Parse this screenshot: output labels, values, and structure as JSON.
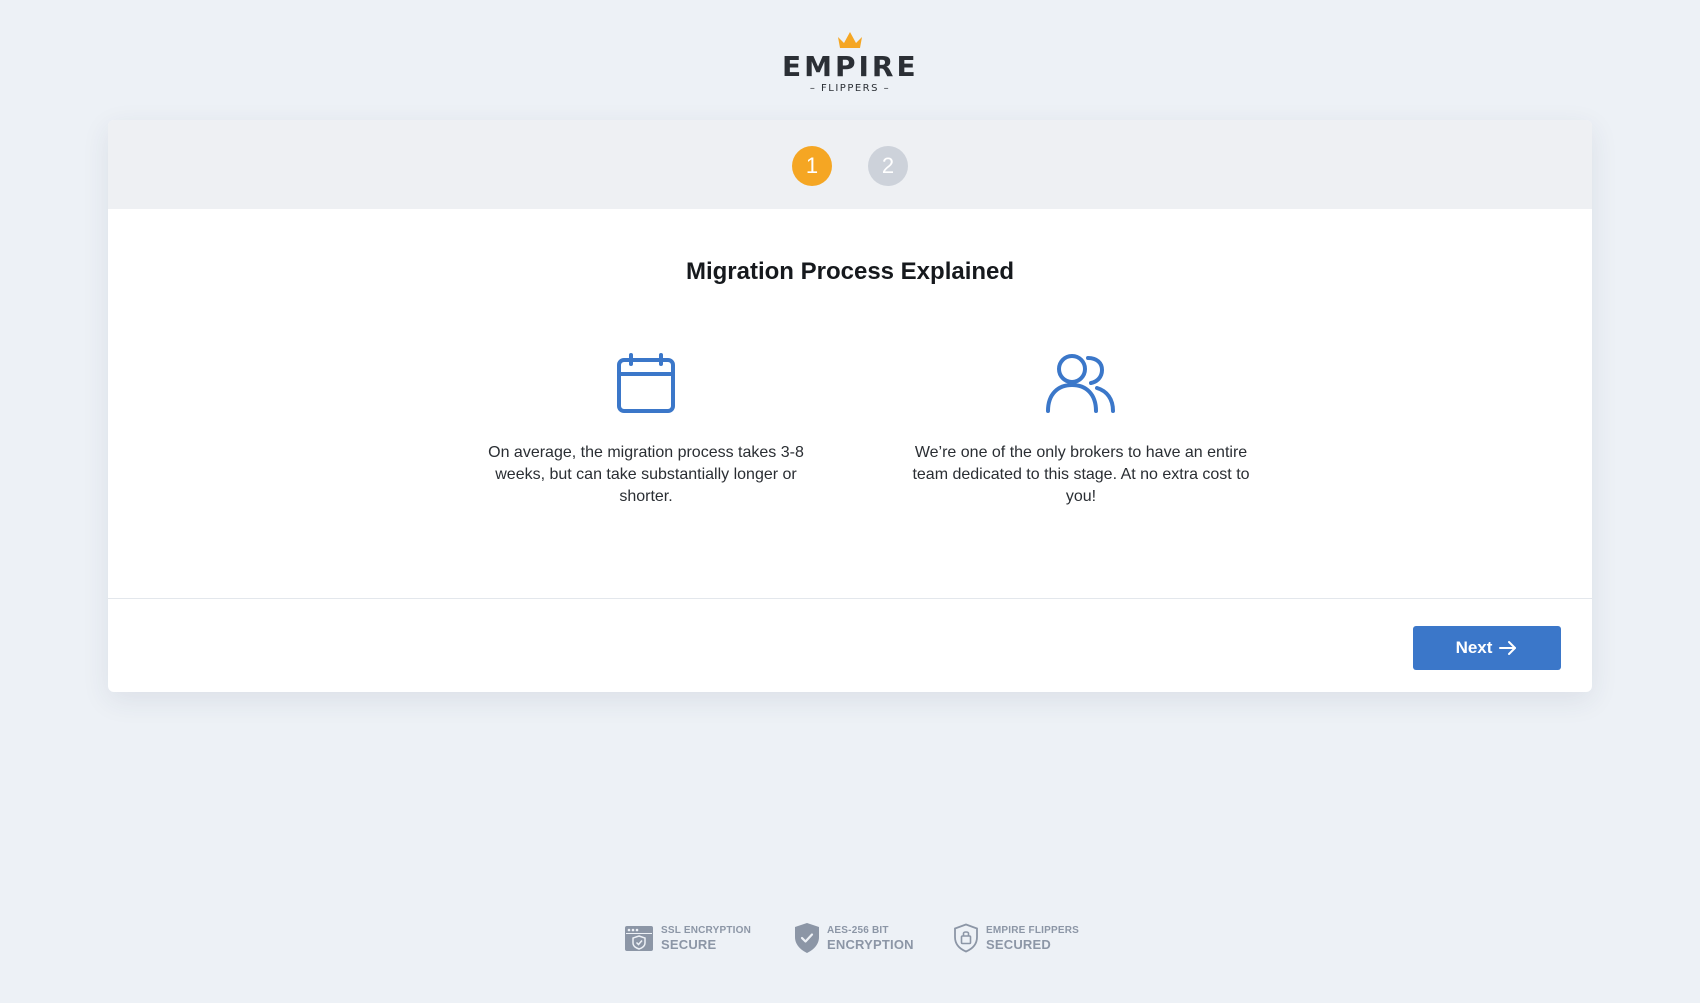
{
  "brand": {
    "name": "EMPIRE",
    "sub": "– FLIPPERS –",
    "crown_color": "#f5a623"
  },
  "stepper": {
    "steps": [
      {
        "label": "1",
        "state": "active"
      },
      {
        "label": "2",
        "state": "inactive"
      }
    ],
    "active_color": "#f5a623",
    "inactive_color": "#cdd2da"
  },
  "main": {
    "title": "Migration Process Explained",
    "features": [
      {
        "icon": "calendar-icon",
        "text": "On average, the migration process takes 3-8 weeks, but can take substantially longer or shorter."
      },
      {
        "icon": "users-icon",
        "text": "We’re one of the only brokers to have an entire team dedicated to this stage. At no extra cost to you!"
      }
    ],
    "icon_color": "#3b77c9"
  },
  "footer": {
    "next_label": "Next",
    "next_color": "#3b77c9"
  },
  "security": {
    "badges": [
      {
        "icon": "ssl-browser-icon",
        "top": "SSL ENCRYPTION",
        "bottom": "SECURE"
      },
      {
        "icon": "shield-check-icon",
        "top": "AES-256 BIT",
        "bottom": "ENCRYPTION"
      },
      {
        "icon": "shield-lock-icon",
        "top": "EMPIRE FLIPPERS",
        "bottom": "SECURED"
      }
    ],
    "color": "#8c96a6"
  }
}
